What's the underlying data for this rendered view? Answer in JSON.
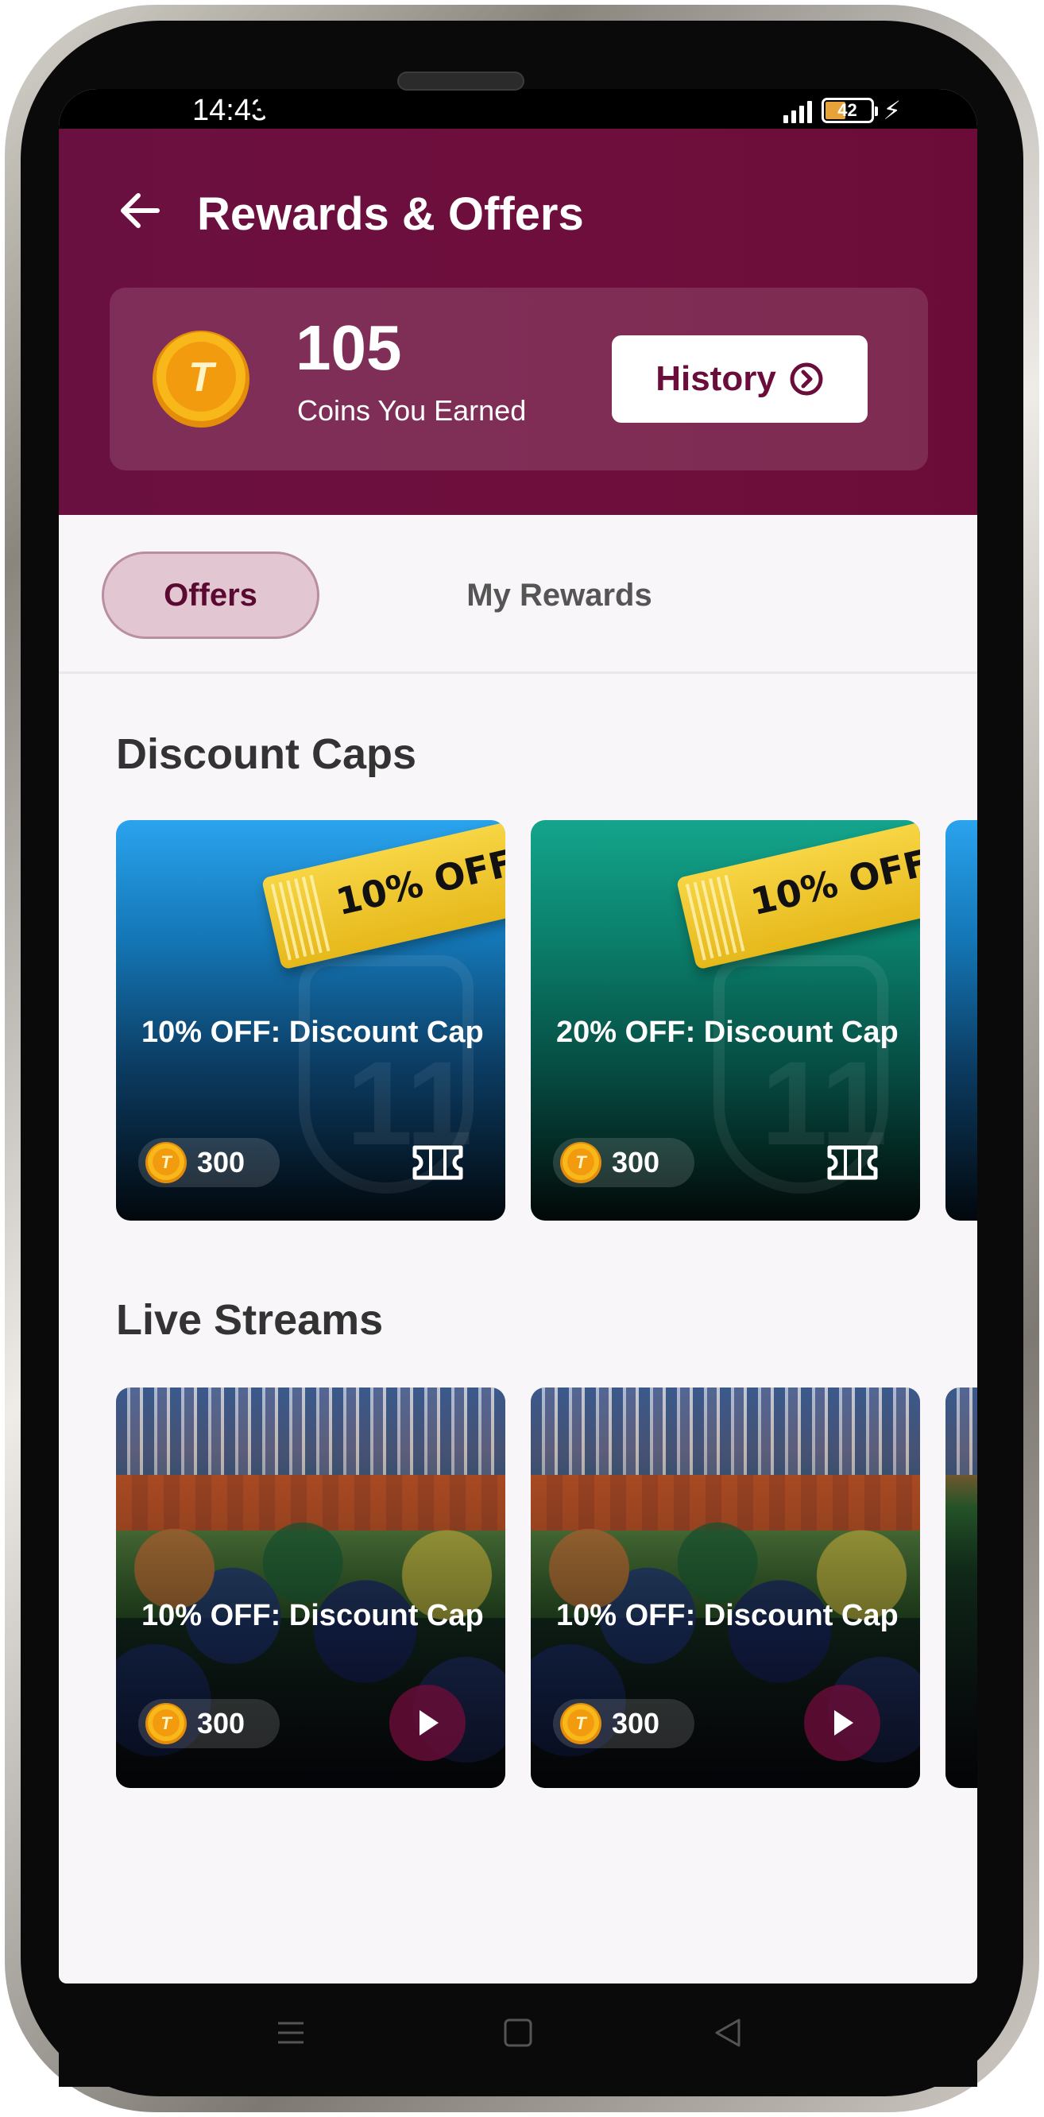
{
  "status_bar": {
    "time": "14:43",
    "battery_level": "42",
    "battery_percent": 42
  },
  "header": {
    "title": "Rewards & Offers",
    "coins_value": "105",
    "coins_label": "Coins You Earned",
    "coin_letter": "T",
    "history_label": "History"
  },
  "tabs": [
    {
      "label": "Offers",
      "active": true
    },
    {
      "label": "My Rewards",
      "active": false
    }
  ],
  "sections": {
    "discount_caps": {
      "title": "Discount Caps",
      "cards": [
        {
          "badge": "10% OFF",
          "title": "10% OFF: Discount Cap",
          "price": "300",
          "theme": "blue"
        },
        {
          "badge": "10% OFF",
          "title": "20% OFF: Discount Cap",
          "price": "300",
          "theme": "teal"
        }
      ]
    },
    "live_streams": {
      "title": "Live Streams",
      "cards": [
        {
          "title": "10% OFF: Discount Cap",
          "price": "300"
        },
        {
          "title": "10% OFF: Discount Cap",
          "price": "300"
        }
      ]
    }
  },
  "colors": {
    "brand": "#6b0d3b",
    "tab_active_bg": "#e2c7d3",
    "coin": "#f5a70f"
  },
  "icons": {
    "back": "arrow-left-icon",
    "history": "chevron-circle-right-icon",
    "coin": "coin-icon",
    "ticket": "ticket-icon",
    "play": "play-icon"
  }
}
